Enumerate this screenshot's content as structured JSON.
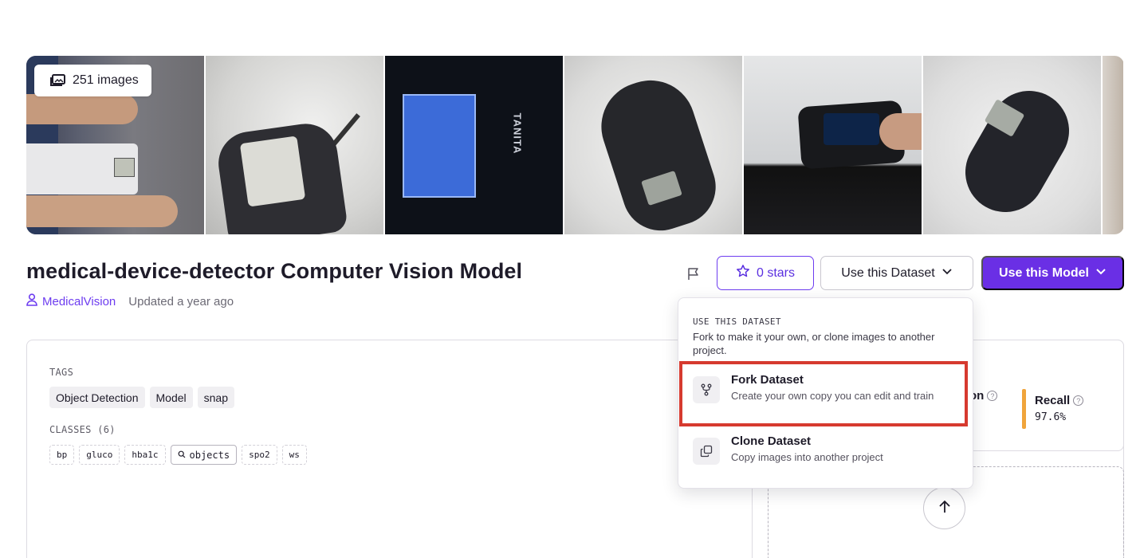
{
  "gallery": {
    "image_count": "251 images"
  },
  "header": {
    "title": "medical-device-detector Computer Vision Model",
    "owner": "MedicalVision",
    "updated": "Updated a year ago",
    "stars_label": "0 stars",
    "use_dataset_label": "Use this Dataset",
    "use_model_label": "Use this Model"
  },
  "tags_section": {
    "label": "TAGS",
    "tags": [
      "Object Detection",
      "Model",
      "snap"
    ]
  },
  "classes_section": {
    "label": "CLASSES (6)",
    "classes": [
      "bp",
      "gluco",
      "hba1c",
      "objects",
      "spo2",
      "ws"
    ]
  },
  "metrics": {
    "partial_label": "on",
    "recall_label": "Recall",
    "recall_value": "97.6%",
    "recall_color": "#f0a43b"
  },
  "dropdown": {
    "heading": "USE THIS DATASET",
    "description": "Fork to make it your own, or clone images to another project.",
    "items": [
      {
        "title": "Fork Dataset",
        "subtitle": "Create your own copy you can edit and train",
        "icon": "fork-icon"
      },
      {
        "title": "Clone Dataset",
        "subtitle": "Copy images into another project",
        "icon": "clone-icon"
      }
    ]
  },
  "colors": {
    "accent": "#6a2fe5",
    "highlight": "#d63a2f"
  }
}
